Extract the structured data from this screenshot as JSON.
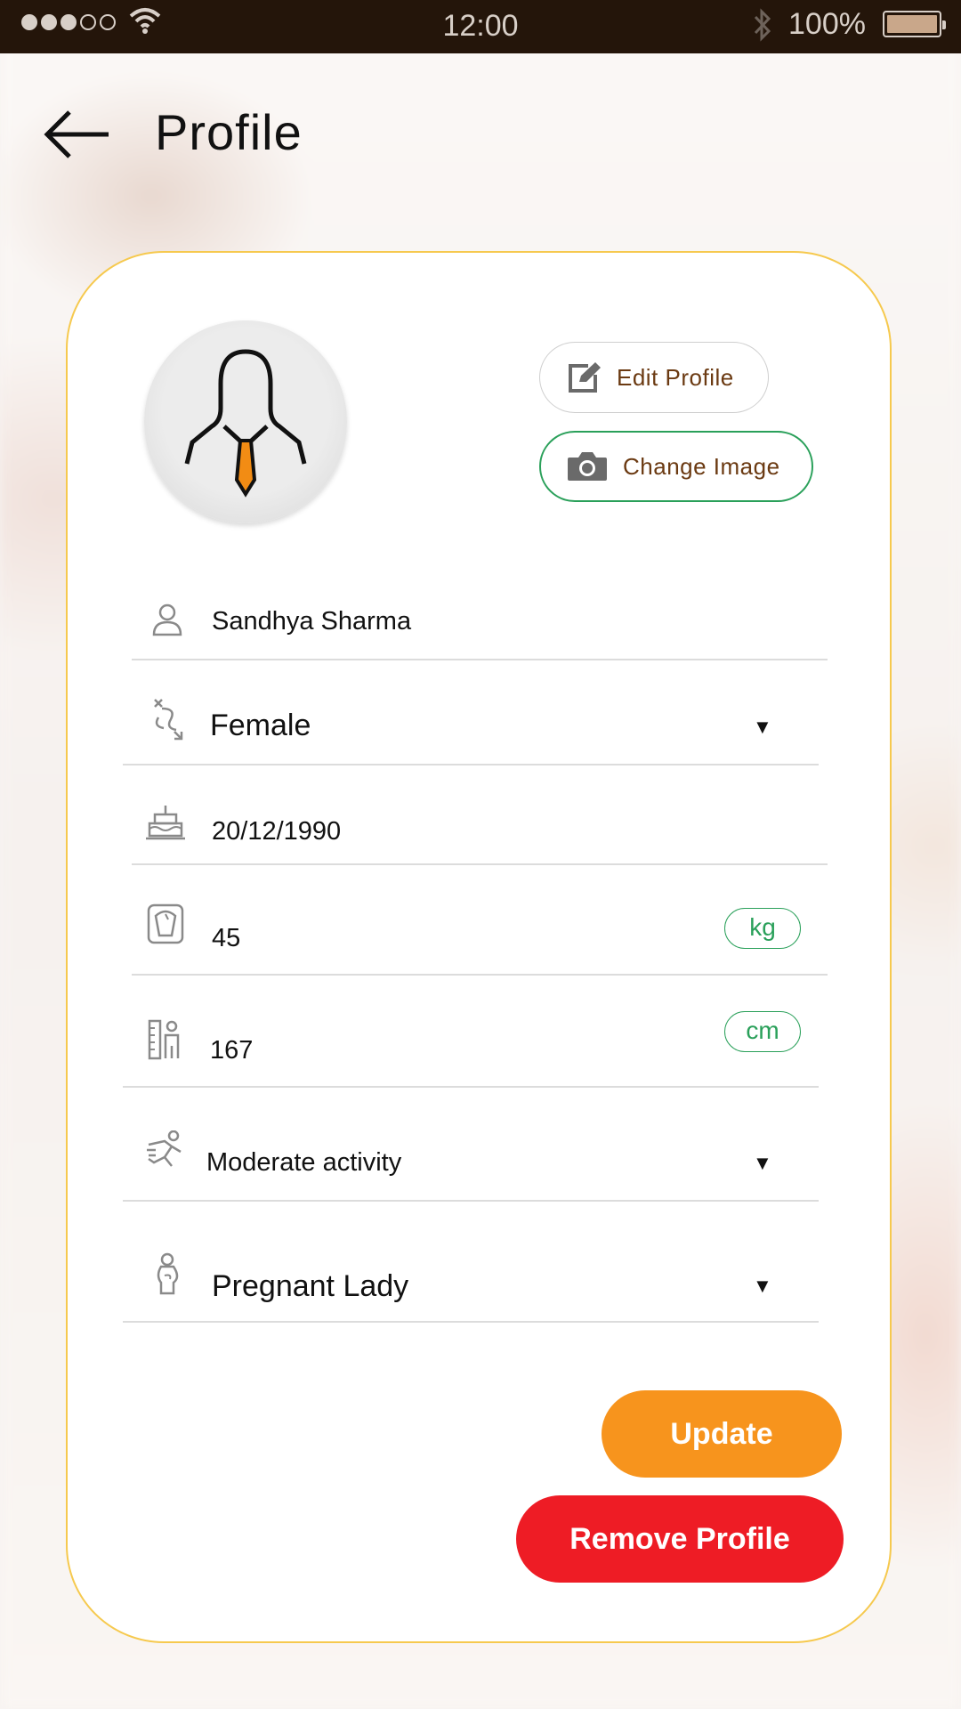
{
  "status_bar": {
    "time": "12:00",
    "battery_percent": "100%"
  },
  "header": {
    "title": "Profile"
  },
  "profile": {
    "edit_label": "Edit Profile",
    "change_image_label": "Change Image",
    "fields": {
      "name": "Sandhya Sharma",
      "gender": "Female",
      "dob": "20/12/1990",
      "weight": "45",
      "weight_unit": "kg",
      "height": "167",
      "height_unit": "cm",
      "activity": "Moderate activity",
      "category": "Pregnant Lady"
    },
    "update_label": "Update",
    "remove_label": "Remove Profile"
  },
  "colors": {
    "accent_orange": "#f7941d",
    "danger_red": "#ee1c25",
    "green": "#2aa05a",
    "card_border": "#f6c94e",
    "status_bar_bg": "#24150a"
  }
}
